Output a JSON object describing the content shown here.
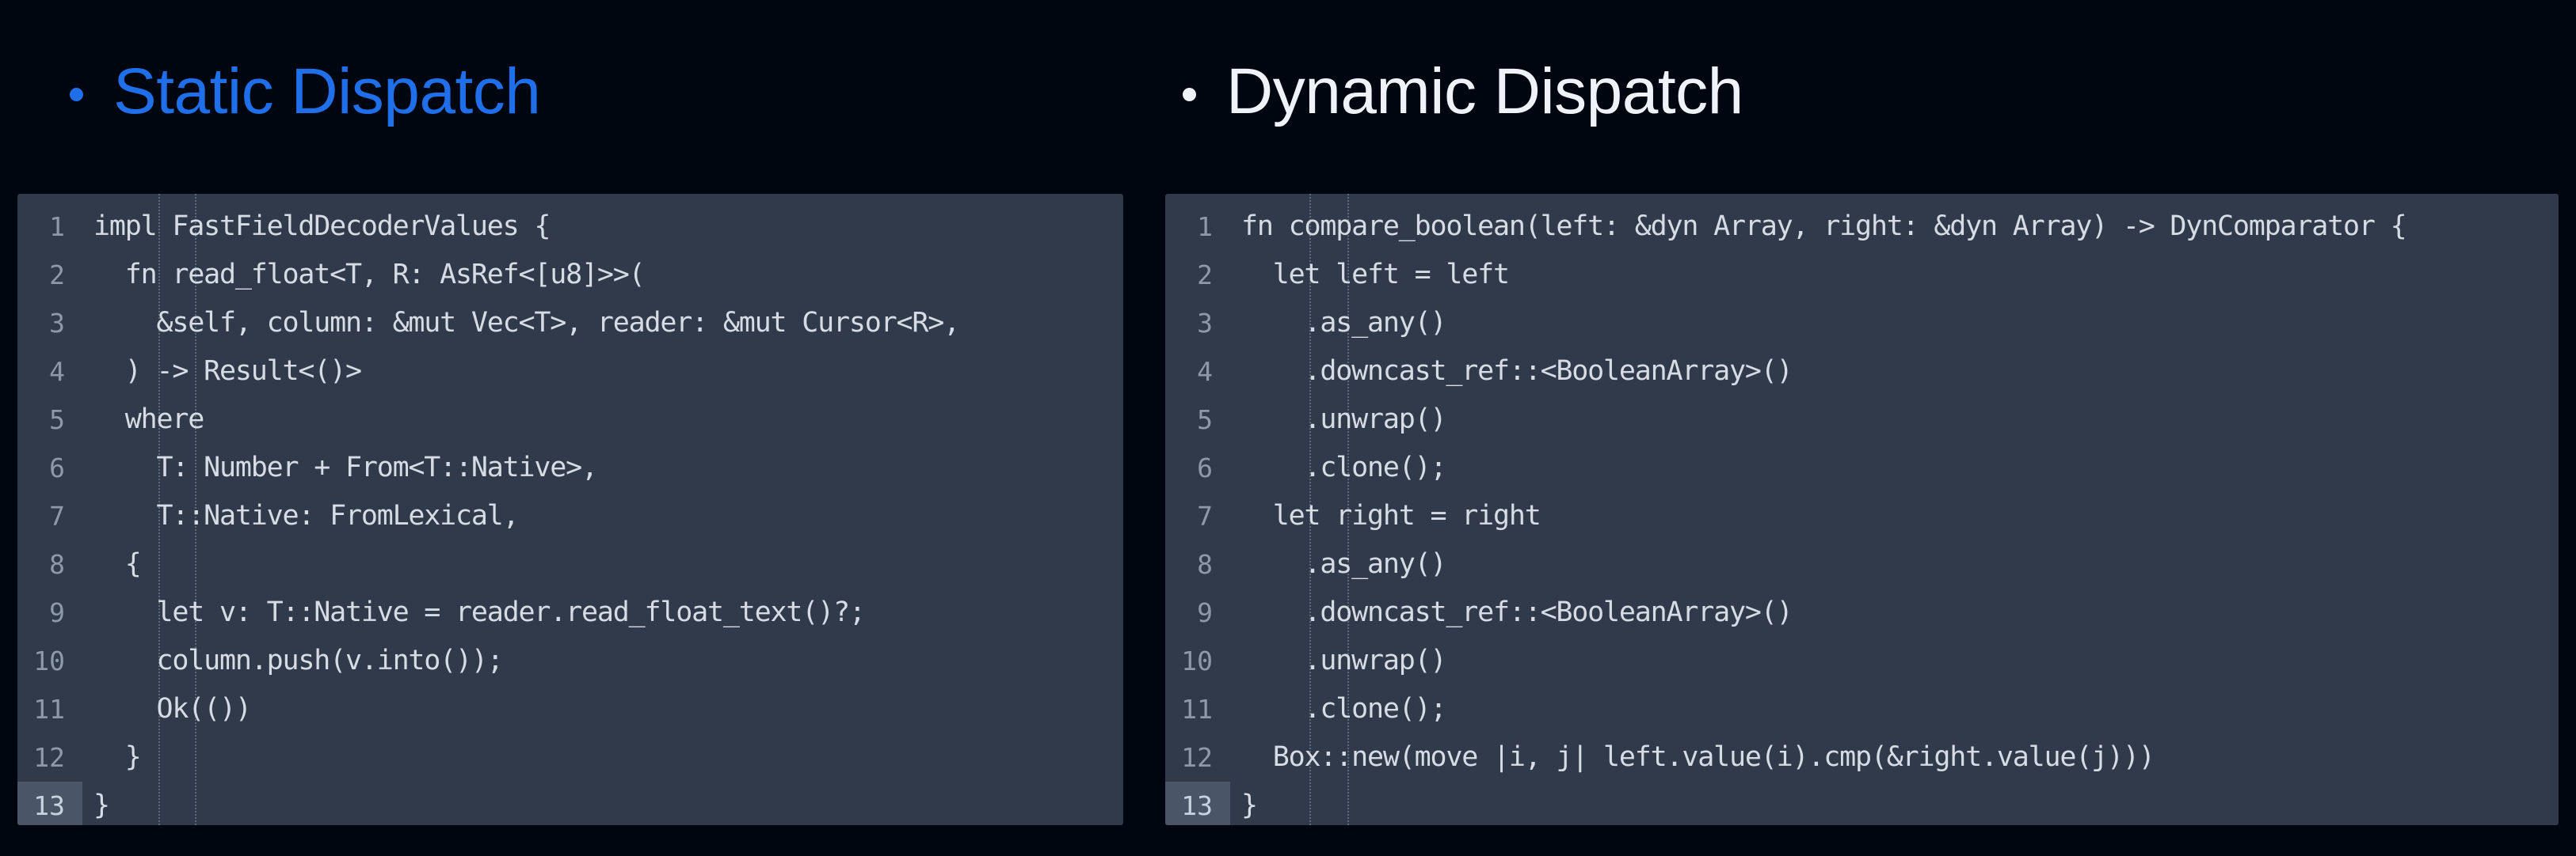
{
  "slide": {
    "background_color": "#000610"
  },
  "headings": [
    {
      "bullet": "bullet-dot",
      "label": "Static Dispatch",
      "color": "#1f6feb"
    },
    {
      "bullet": "bullet-dot",
      "label": "Dynamic Dispatch",
      "color": "#f0f2fa"
    }
  ],
  "code_panels": {
    "background_color": "#303a4a",
    "text_color": "#d6dbe4",
    "gutter_color": "#8d99a9",
    "highlight_color": "#4a5668",
    "left": {
      "language": "rust",
      "active_line": 13,
      "lines": [
        {
          "number": "1",
          "text": "impl FastFieldDecoderValues {"
        },
        {
          "number": "2",
          "text": "  fn read_float<T, R: AsRef<[u8]>>("
        },
        {
          "number": "3",
          "text": "    &self, column: &mut Vec<T>, reader: &mut Cursor<R>,"
        },
        {
          "number": "4",
          "text": "  ) -> Result<()>"
        },
        {
          "number": "5",
          "text": "  where"
        },
        {
          "number": "6",
          "text": "    T: Number + From<T::Native>,"
        },
        {
          "number": "7",
          "text": "    T::Native: FromLexical,"
        },
        {
          "number": "8",
          "text": "  {"
        },
        {
          "number": "9",
          "text": "    let v: T::Native = reader.read_float_text()?;"
        },
        {
          "number": "10",
          "text": "    column.push(v.into());"
        },
        {
          "number": "11",
          "text": "    Ok(())"
        },
        {
          "number": "12",
          "text": "  }"
        },
        {
          "number": "13",
          "text": "}"
        }
      ]
    },
    "right": {
      "language": "rust",
      "active_line": 13,
      "lines": [
        {
          "number": "1",
          "text": "fn compare_boolean(left: &dyn Array, right: &dyn Array) -> DynComparator {"
        },
        {
          "number": "2",
          "text": "  let left = left"
        },
        {
          "number": "3",
          "text": "    .as_any()"
        },
        {
          "number": "4",
          "text": "    .downcast_ref::<BooleanArray>()"
        },
        {
          "number": "5",
          "text": "    .unwrap()"
        },
        {
          "number": "6",
          "text": "    .clone();"
        },
        {
          "number": "7",
          "text": "  let right = right"
        },
        {
          "number": "8",
          "text": "    .as_any()"
        },
        {
          "number": "9",
          "text": "    .downcast_ref::<BooleanArray>()"
        },
        {
          "number": "10",
          "text": "    .unwrap()"
        },
        {
          "number": "11",
          "text": "    .clone();"
        },
        {
          "number": "12",
          "text": "  Box::new(move |i, j| left.value(i).cmp(&right.value(j)))"
        },
        {
          "number": "13",
          "text": "}"
        }
      ]
    }
  }
}
